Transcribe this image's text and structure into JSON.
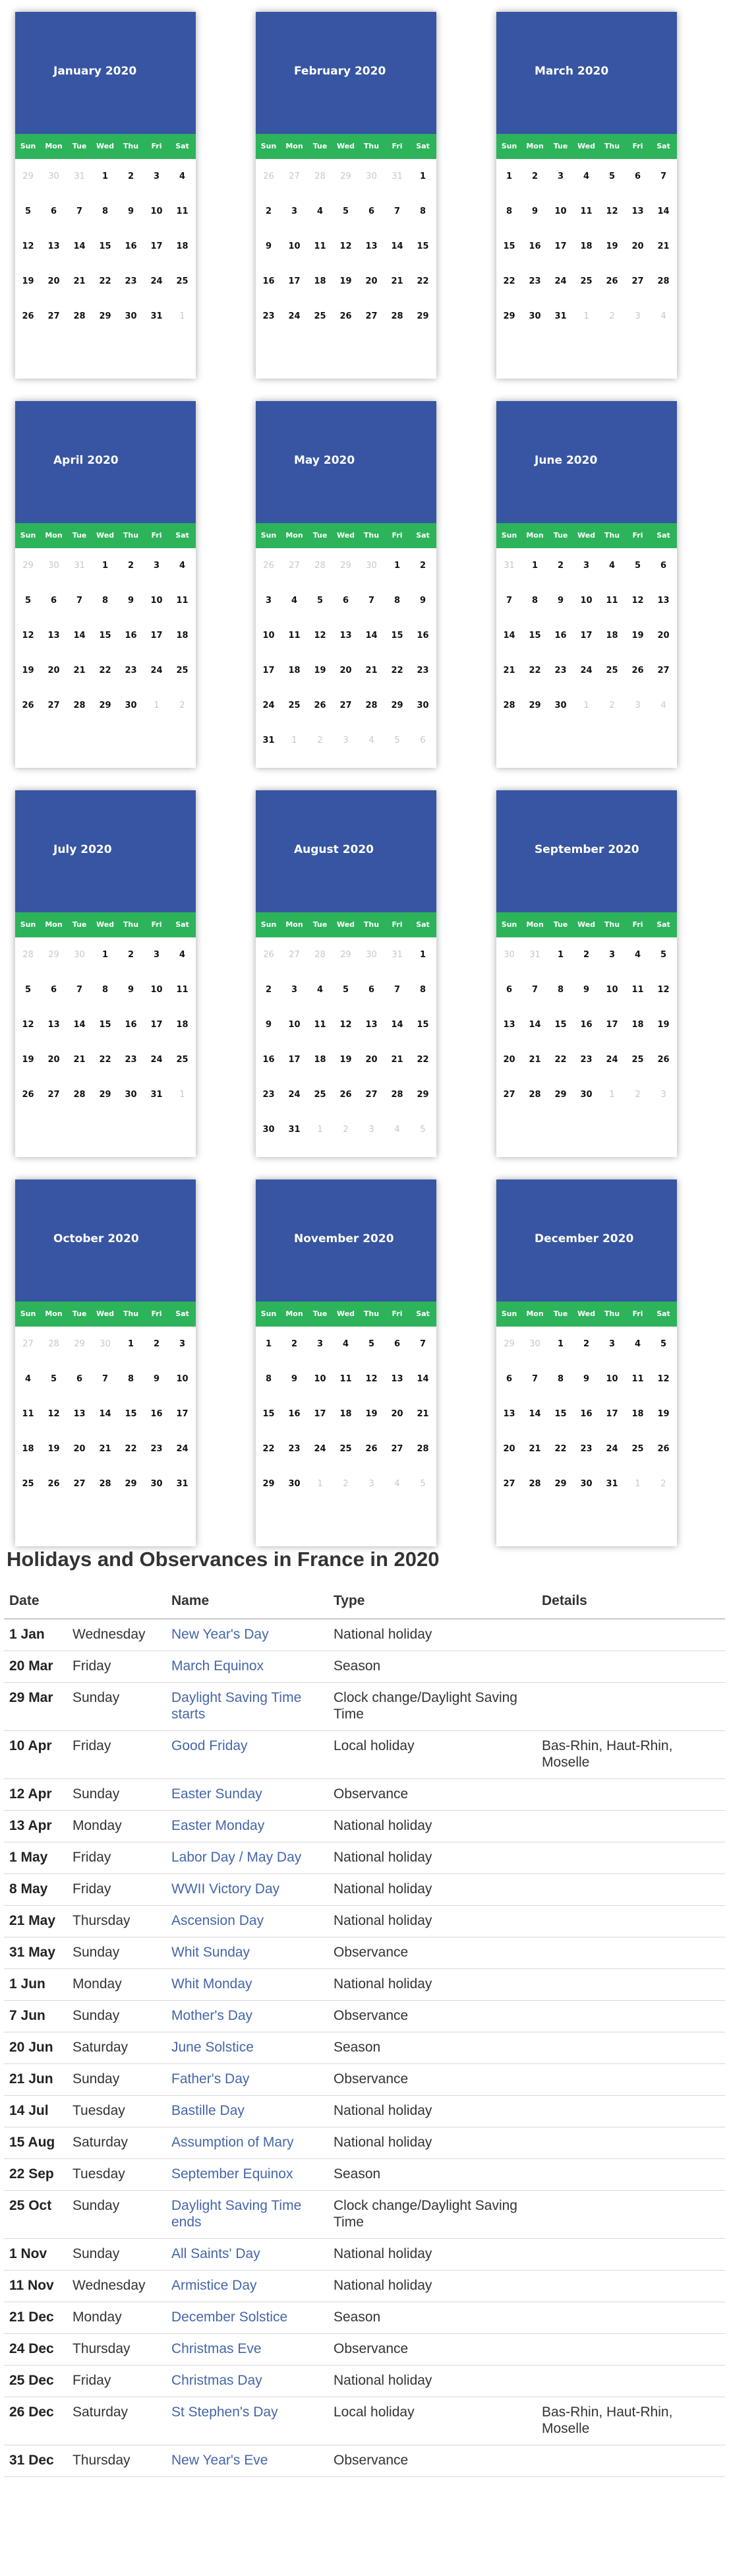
{
  "weekdays": [
    "Sun",
    "Mon",
    "Tue",
    "Wed",
    "Thu",
    "Fri",
    "Sat"
  ],
  "months": [
    {
      "title": "January 2020",
      "weeks": [
        [
          "29",
          "30",
          "31",
          "1",
          "2",
          "3",
          "4"
        ],
        [
          "5",
          "6",
          "7",
          "8",
          "9",
          "10",
          "11"
        ],
        [
          "12",
          "13",
          "14",
          "15",
          "16",
          "17",
          "18"
        ],
        [
          "19",
          "20",
          "21",
          "22",
          "23",
          "24",
          "25"
        ],
        [
          "26",
          "27",
          "28",
          "29",
          "30",
          "31",
          "1"
        ]
      ]
    },
    {
      "title": "February 2020",
      "weeks": [
        [
          "26",
          "27",
          "28",
          "29",
          "30",
          "31",
          "1"
        ],
        [
          "2",
          "3",
          "4",
          "5",
          "6",
          "7",
          "8"
        ],
        [
          "9",
          "10",
          "11",
          "12",
          "13",
          "14",
          "15"
        ],
        [
          "16",
          "17",
          "18",
          "19",
          "20",
          "21",
          "22"
        ],
        [
          "23",
          "24",
          "25",
          "26",
          "27",
          "28",
          "29"
        ]
      ]
    },
    {
      "title": "March 2020",
      "weeks": [
        [
          "1",
          "2",
          "3",
          "4",
          "5",
          "6",
          "7"
        ],
        [
          "8",
          "9",
          "10",
          "11",
          "12",
          "13",
          "14"
        ],
        [
          "15",
          "16",
          "17",
          "18",
          "19",
          "20",
          "21"
        ],
        [
          "22",
          "23",
          "24",
          "25",
          "26",
          "27",
          "28"
        ],
        [
          "29",
          "30",
          "31",
          "1",
          "2",
          "3",
          "4"
        ]
      ]
    },
    {
      "title": "April 2020",
      "weeks": [
        [
          "29",
          "30",
          "31",
          "1",
          "2",
          "3",
          "4"
        ],
        [
          "5",
          "6",
          "7",
          "8",
          "9",
          "10",
          "11"
        ],
        [
          "12",
          "13",
          "14",
          "15",
          "16",
          "17",
          "18"
        ],
        [
          "19",
          "20",
          "21",
          "22",
          "23",
          "24",
          "25"
        ],
        [
          "26",
          "27",
          "28",
          "29",
          "30",
          "1",
          "2"
        ]
      ]
    },
    {
      "title": "May 2020",
      "weeks": [
        [
          "26",
          "27",
          "28",
          "29",
          "30",
          "1",
          "2"
        ],
        [
          "3",
          "4",
          "5",
          "6",
          "7",
          "8",
          "9"
        ],
        [
          "10",
          "11",
          "12",
          "13",
          "14",
          "15",
          "16"
        ],
        [
          "17",
          "18",
          "19",
          "20",
          "21",
          "22",
          "23"
        ],
        [
          "24",
          "25",
          "26",
          "27",
          "28",
          "29",
          "30"
        ],
        [
          "31",
          "1",
          "2",
          "3",
          "4",
          "5",
          "6"
        ]
      ]
    },
    {
      "title": "June 2020",
      "weeks": [
        [
          "31",
          "1",
          "2",
          "3",
          "4",
          "5",
          "6"
        ],
        [
          "7",
          "8",
          "9",
          "10",
          "11",
          "12",
          "13"
        ],
        [
          "14",
          "15",
          "16",
          "17",
          "18",
          "19",
          "20"
        ],
        [
          "21",
          "22",
          "23",
          "24",
          "25",
          "26",
          "27"
        ],
        [
          "28",
          "29",
          "30",
          "1",
          "2",
          "3",
          "4"
        ]
      ]
    },
    {
      "title": "July 2020",
      "weeks": [
        [
          "28",
          "29",
          "30",
          "1",
          "2",
          "3",
          "4"
        ],
        [
          "5",
          "6",
          "7",
          "8",
          "9",
          "10",
          "11"
        ],
        [
          "12",
          "13",
          "14",
          "15",
          "16",
          "17",
          "18"
        ],
        [
          "19",
          "20",
          "21",
          "22",
          "23",
          "24",
          "25"
        ],
        [
          "26",
          "27",
          "28",
          "29",
          "30",
          "31",
          "1"
        ]
      ]
    },
    {
      "title": "August 2020",
      "weeks": [
        [
          "26",
          "27",
          "28",
          "29",
          "30",
          "31",
          "1"
        ],
        [
          "2",
          "3",
          "4",
          "5",
          "6",
          "7",
          "8"
        ],
        [
          "9",
          "10",
          "11",
          "12",
          "13",
          "14",
          "15"
        ],
        [
          "16",
          "17",
          "18",
          "19",
          "20",
          "21",
          "22"
        ],
        [
          "23",
          "24",
          "25",
          "26",
          "27",
          "28",
          "29"
        ],
        [
          "30",
          "31",
          "1",
          "2",
          "3",
          "4",
          "5"
        ]
      ]
    },
    {
      "title": "September 2020",
      "weeks": [
        [
          "30",
          "31",
          "1",
          "2",
          "3",
          "4",
          "5"
        ],
        [
          "6",
          "7",
          "8",
          "9",
          "10",
          "11",
          "12"
        ],
        [
          "13",
          "14",
          "15",
          "16",
          "17",
          "18",
          "19"
        ],
        [
          "20",
          "21",
          "22",
          "23",
          "24",
          "25",
          "26"
        ],
        [
          "27",
          "28",
          "29",
          "30",
          "1",
          "2",
          "3"
        ]
      ]
    },
    {
      "title": "October 2020",
      "weeks": [
        [
          "27",
          "28",
          "29",
          "30",
          "1",
          "2",
          "3"
        ],
        [
          "4",
          "5",
          "6",
          "7",
          "8",
          "9",
          "10"
        ],
        [
          "11",
          "12",
          "13",
          "14",
          "15",
          "16",
          "17"
        ],
        [
          "18",
          "19",
          "20",
          "21",
          "22",
          "23",
          "24"
        ],
        [
          "25",
          "26",
          "27",
          "28",
          "29",
          "30",
          "31"
        ]
      ]
    },
    {
      "title": "November 2020",
      "weeks": [
        [
          "1",
          "2",
          "3",
          "4",
          "5",
          "6",
          "7"
        ],
        [
          "8",
          "9",
          "10",
          "11",
          "12",
          "13",
          "14"
        ],
        [
          "15",
          "16",
          "17",
          "18",
          "19",
          "20",
          "21"
        ],
        [
          "22",
          "23",
          "24",
          "25",
          "26",
          "27",
          "28"
        ],
        [
          "29",
          "30",
          "1",
          "2",
          "3",
          "4",
          "5"
        ]
      ]
    },
    {
      "title": "December 2020",
      "weeks": [
        [
          "29",
          "30",
          "1",
          "2",
          "3",
          "4",
          "5"
        ],
        [
          "6",
          "7",
          "8",
          "9",
          "10",
          "11",
          "12"
        ],
        [
          "13",
          "14",
          "15",
          "16",
          "17",
          "18",
          "19"
        ],
        [
          "20",
          "21",
          "22",
          "23",
          "24",
          "25",
          "26"
        ],
        [
          "27",
          "28",
          "29",
          "30",
          "31",
          "1",
          "2"
        ]
      ]
    }
  ],
  "holidays": {
    "title": "Holidays and Observances in France in 2020",
    "headers": {
      "date": "Date",
      "name": "Name",
      "type": "Type",
      "details": "Details"
    },
    "rows": [
      {
        "date": "1 Jan",
        "weekday": "Wednesday",
        "name": "New Year's Day",
        "type": "National holiday",
        "details": ""
      },
      {
        "date": "20 Mar",
        "weekday": "Friday",
        "name": "March Equinox",
        "type": "Season",
        "details": ""
      },
      {
        "date": "29 Mar",
        "weekday": "Sunday",
        "name": "Daylight Saving Time starts",
        "type": "Clock change/Daylight Saving Time",
        "details": ""
      },
      {
        "date": "10 Apr",
        "weekday": "Friday",
        "name": "Good Friday",
        "type": "Local holiday",
        "details": "Bas-Rhin, Haut-Rhin, Moselle"
      },
      {
        "date": "12 Apr",
        "weekday": "Sunday",
        "name": "Easter Sunday",
        "type": "Observance",
        "details": ""
      },
      {
        "date": "13 Apr",
        "weekday": "Monday",
        "name": "Easter Monday",
        "type": "National holiday",
        "details": ""
      },
      {
        "date": "1 May",
        "weekday": "Friday",
        "name": "Labor Day / May Day",
        "type": "National holiday",
        "details": ""
      },
      {
        "date": "8 May",
        "weekday": "Friday",
        "name": "WWII Victory Day",
        "type": "National holiday",
        "details": ""
      },
      {
        "date": "21 May",
        "weekday": "Thursday",
        "name": "Ascension Day",
        "type": "National holiday",
        "details": ""
      },
      {
        "date": "31 May",
        "weekday": "Sunday",
        "name": "Whit Sunday",
        "type": "Observance",
        "details": ""
      },
      {
        "date": "1 Jun",
        "weekday": "Monday",
        "name": "Whit Monday",
        "type": "National holiday",
        "details": ""
      },
      {
        "date": "7 Jun",
        "weekday": "Sunday",
        "name": "Mother's Day",
        "type": "Observance",
        "details": ""
      },
      {
        "date": "20 Jun",
        "weekday": "Saturday",
        "name": "June Solstice",
        "type": "Season",
        "details": ""
      },
      {
        "date": "21 Jun",
        "weekday": "Sunday",
        "name": "Father's Day",
        "type": "Observance",
        "details": ""
      },
      {
        "date": "14 Jul",
        "weekday": "Tuesday",
        "name": "Bastille Day",
        "type": "National holiday",
        "details": ""
      },
      {
        "date": "15 Aug",
        "weekday": "Saturday",
        "name": "Assumption of Mary",
        "type": "National holiday",
        "details": ""
      },
      {
        "date": "22 Sep",
        "weekday": "Tuesday",
        "name": "September Equinox",
        "type": "Season",
        "details": ""
      },
      {
        "date": "25 Oct",
        "weekday": "Sunday",
        "name": "Daylight Saving Time ends",
        "type": "Clock change/Daylight Saving Time",
        "details": ""
      },
      {
        "date": "1 Nov",
        "weekday": "Sunday",
        "name": "All Saints' Day",
        "type": "National holiday",
        "details": ""
      },
      {
        "date": "11 Nov",
        "weekday": "Wednesday",
        "name": "Armistice Day",
        "type": "National holiday",
        "details": ""
      },
      {
        "date": "21 Dec",
        "weekday": "Monday",
        "name": "December Solstice",
        "type": "Season",
        "details": ""
      },
      {
        "date": "24 Dec",
        "weekday": "Thursday",
        "name": "Christmas Eve",
        "type": "Observance",
        "details": ""
      },
      {
        "date": "25 Dec",
        "weekday": "Friday",
        "name": "Christmas Day",
        "type": "National holiday",
        "details": ""
      },
      {
        "date": "26 Dec",
        "weekday": "Saturday",
        "name": "St Stephen's Day",
        "type": "Local holiday",
        "details": "Bas-Rhin, Haut-Rhin, Moselle"
      },
      {
        "date": "31 Dec",
        "weekday": "Thursday",
        "name": "New Year's Eve",
        "type": "Observance",
        "details": ""
      }
    ]
  },
  "colors": {
    "header": "#3755a2",
    "weekday_bar": "#2db35a",
    "link": "#4466aa",
    "muted_day": "#c8c8c8"
  }
}
